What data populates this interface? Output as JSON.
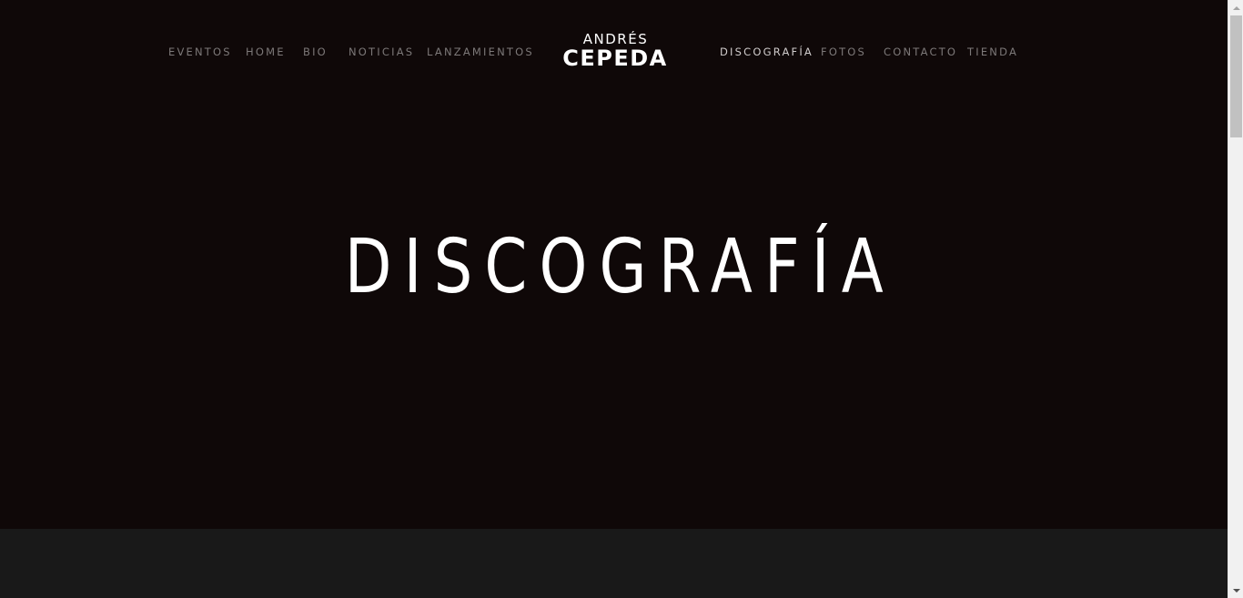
{
  "nav": {
    "left": [
      {
        "label": "EVENTOS"
      },
      {
        "label": "HOME"
      },
      {
        "label": "BIO"
      },
      {
        "label": "NOTICIAS"
      },
      {
        "label": "LANZAMIENTOS"
      }
    ],
    "right": [
      {
        "label": "DISCOGRAFÍA",
        "active": true
      },
      {
        "label": "FOTOS"
      },
      {
        "label": "CONTACTO"
      },
      {
        "label": "TIENDA"
      }
    ]
  },
  "logo": {
    "line1": "ANDRÉS",
    "line2": "CEPEDA"
  },
  "hero": {
    "title": "DISCOGRAFÍA"
  },
  "colors": {
    "hero_bg": "#0f0808",
    "lower_bg": "#191919",
    "nav_text": "#7c7878",
    "nav_active": "#cfcbcb",
    "title_text": "#ffffff"
  }
}
